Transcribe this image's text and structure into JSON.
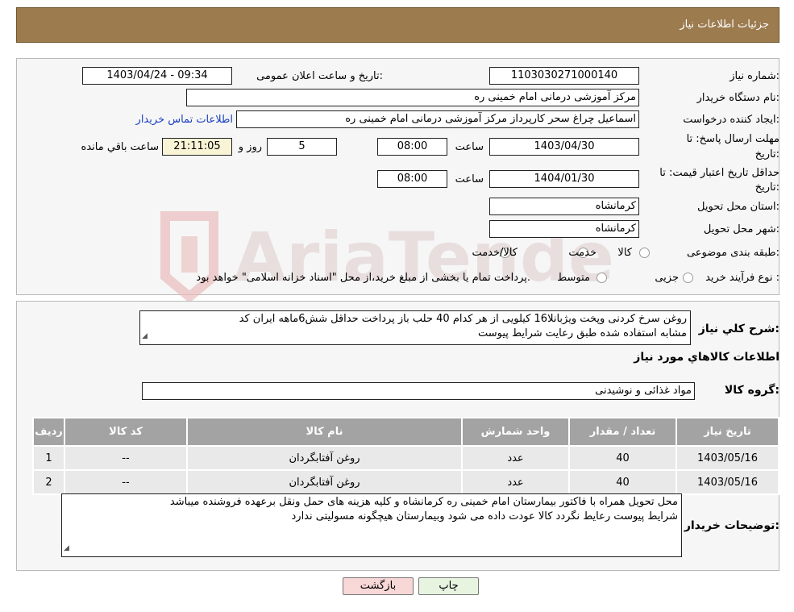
{
  "header": {
    "title": "جزئیات اطلاعات نیاز"
  },
  "details": {
    "need_number_label": "شماره نیاز:",
    "need_number": "1103030271000140",
    "announce_label": "تاریخ و ساعت اعلان عمومی:",
    "announce_value": "1403/04/24 - 09:34",
    "buyer_org_label": "نام دستگاه خریدار:",
    "buyer_org": "مرکز آموزشی درمانی امام خمینی ره",
    "creator_label": "ایجاد کننده درخواست:",
    "creator": "اسماعیل چراغ سحر کارپرداز مرکز آموزشی درمانی امام خمینی ره",
    "contact_link": "اطلاعات تماس خریدار",
    "deadline_label_1": "مهلت ارسال پاسخ: تا",
    "deadline_label_2": "تاریخ:",
    "deadline_date": "1403/04/30",
    "time_label": "ساعت",
    "deadline_time": "08:00",
    "days_value": "5",
    "days_label": "روز و",
    "remaining_time": "21:11:05",
    "remaining_label": "ساعت باقي مانده",
    "validity_label_1": "حداقل تاریخ اعتبار قیمت: تا",
    "validity_label_2": "تاریخ:",
    "validity_date": "1404/01/30",
    "validity_time": "08:00",
    "province_label": "استان محل تحویل:",
    "province": "کرمانشاه",
    "city_label": "شهر محل تحویل:",
    "city": "کرمانشاه",
    "category_label": "طبقه بندی موضوعی:",
    "category_options": [
      "کالا",
      "خدمت",
      "کالا/خدمت"
    ],
    "process_label": "نوع فرآیند خرید :",
    "process_options": [
      "جزیی",
      "متوسط"
    ],
    "process_note": "پرداخت تمام یا بخشی از مبلغ خرید،از محل \"اسناد خزانه اسلامی\" خواهد بود."
  },
  "summary": {
    "label": "شرح کلي نياز:",
    "text_line1": "روغن سرخ کردنی وپخت ویژبانلا16 کیلویی از هر کدام 40 حلب  باز پرداخت حداقل شش6ماهه  ایران کد",
    "text_line2": "مشابه استفاده شده طبق رعایت شرایط پیوست",
    "goods_title": "اطلاعات کالاهاي مورد نياز",
    "group_label": "گروه کالا:",
    "group_value": "مواد غذائی و نوشیدنی"
  },
  "table": {
    "headers": [
      "رديف",
      "کد کالا",
      "نام کالا",
      "واحد شمارش",
      "تعداد / مقدار",
      "تاریخ نیاز"
    ],
    "rows": [
      [
        "1",
        "--",
        "روغن آفتابگردان",
        "عدد",
        "40",
        "1403/05/16"
      ],
      [
        "2",
        "--",
        "روغن آفتابگردان",
        "عدد",
        "40",
        "1403/05/16"
      ]
    ]
  },
  "notes": {
    "label": "توضیحات خریدار:",
    "line1": "محل تحویل همراه با فاکتور بیمارستان امام خمینی ره کرمانشاه و کلیه هزینه های حمل ونقل برعهده فروشنده میباشد",
    "line2": "شرایط پیوست رعایط نگردد کالا عودت داده می شود وبیمارستان هیچگونه مسولیتی ندارد"
  },
  "buttons": {
    "print": "چاپ",
    "back": "بازگشت"
  },
  "colors": {
    "header": "#9c7b4e",
    "back_button": "#f8d7d7",
    "print_button": "#e6f4e0",
    "link": "#1a3fc0"
  }
}
